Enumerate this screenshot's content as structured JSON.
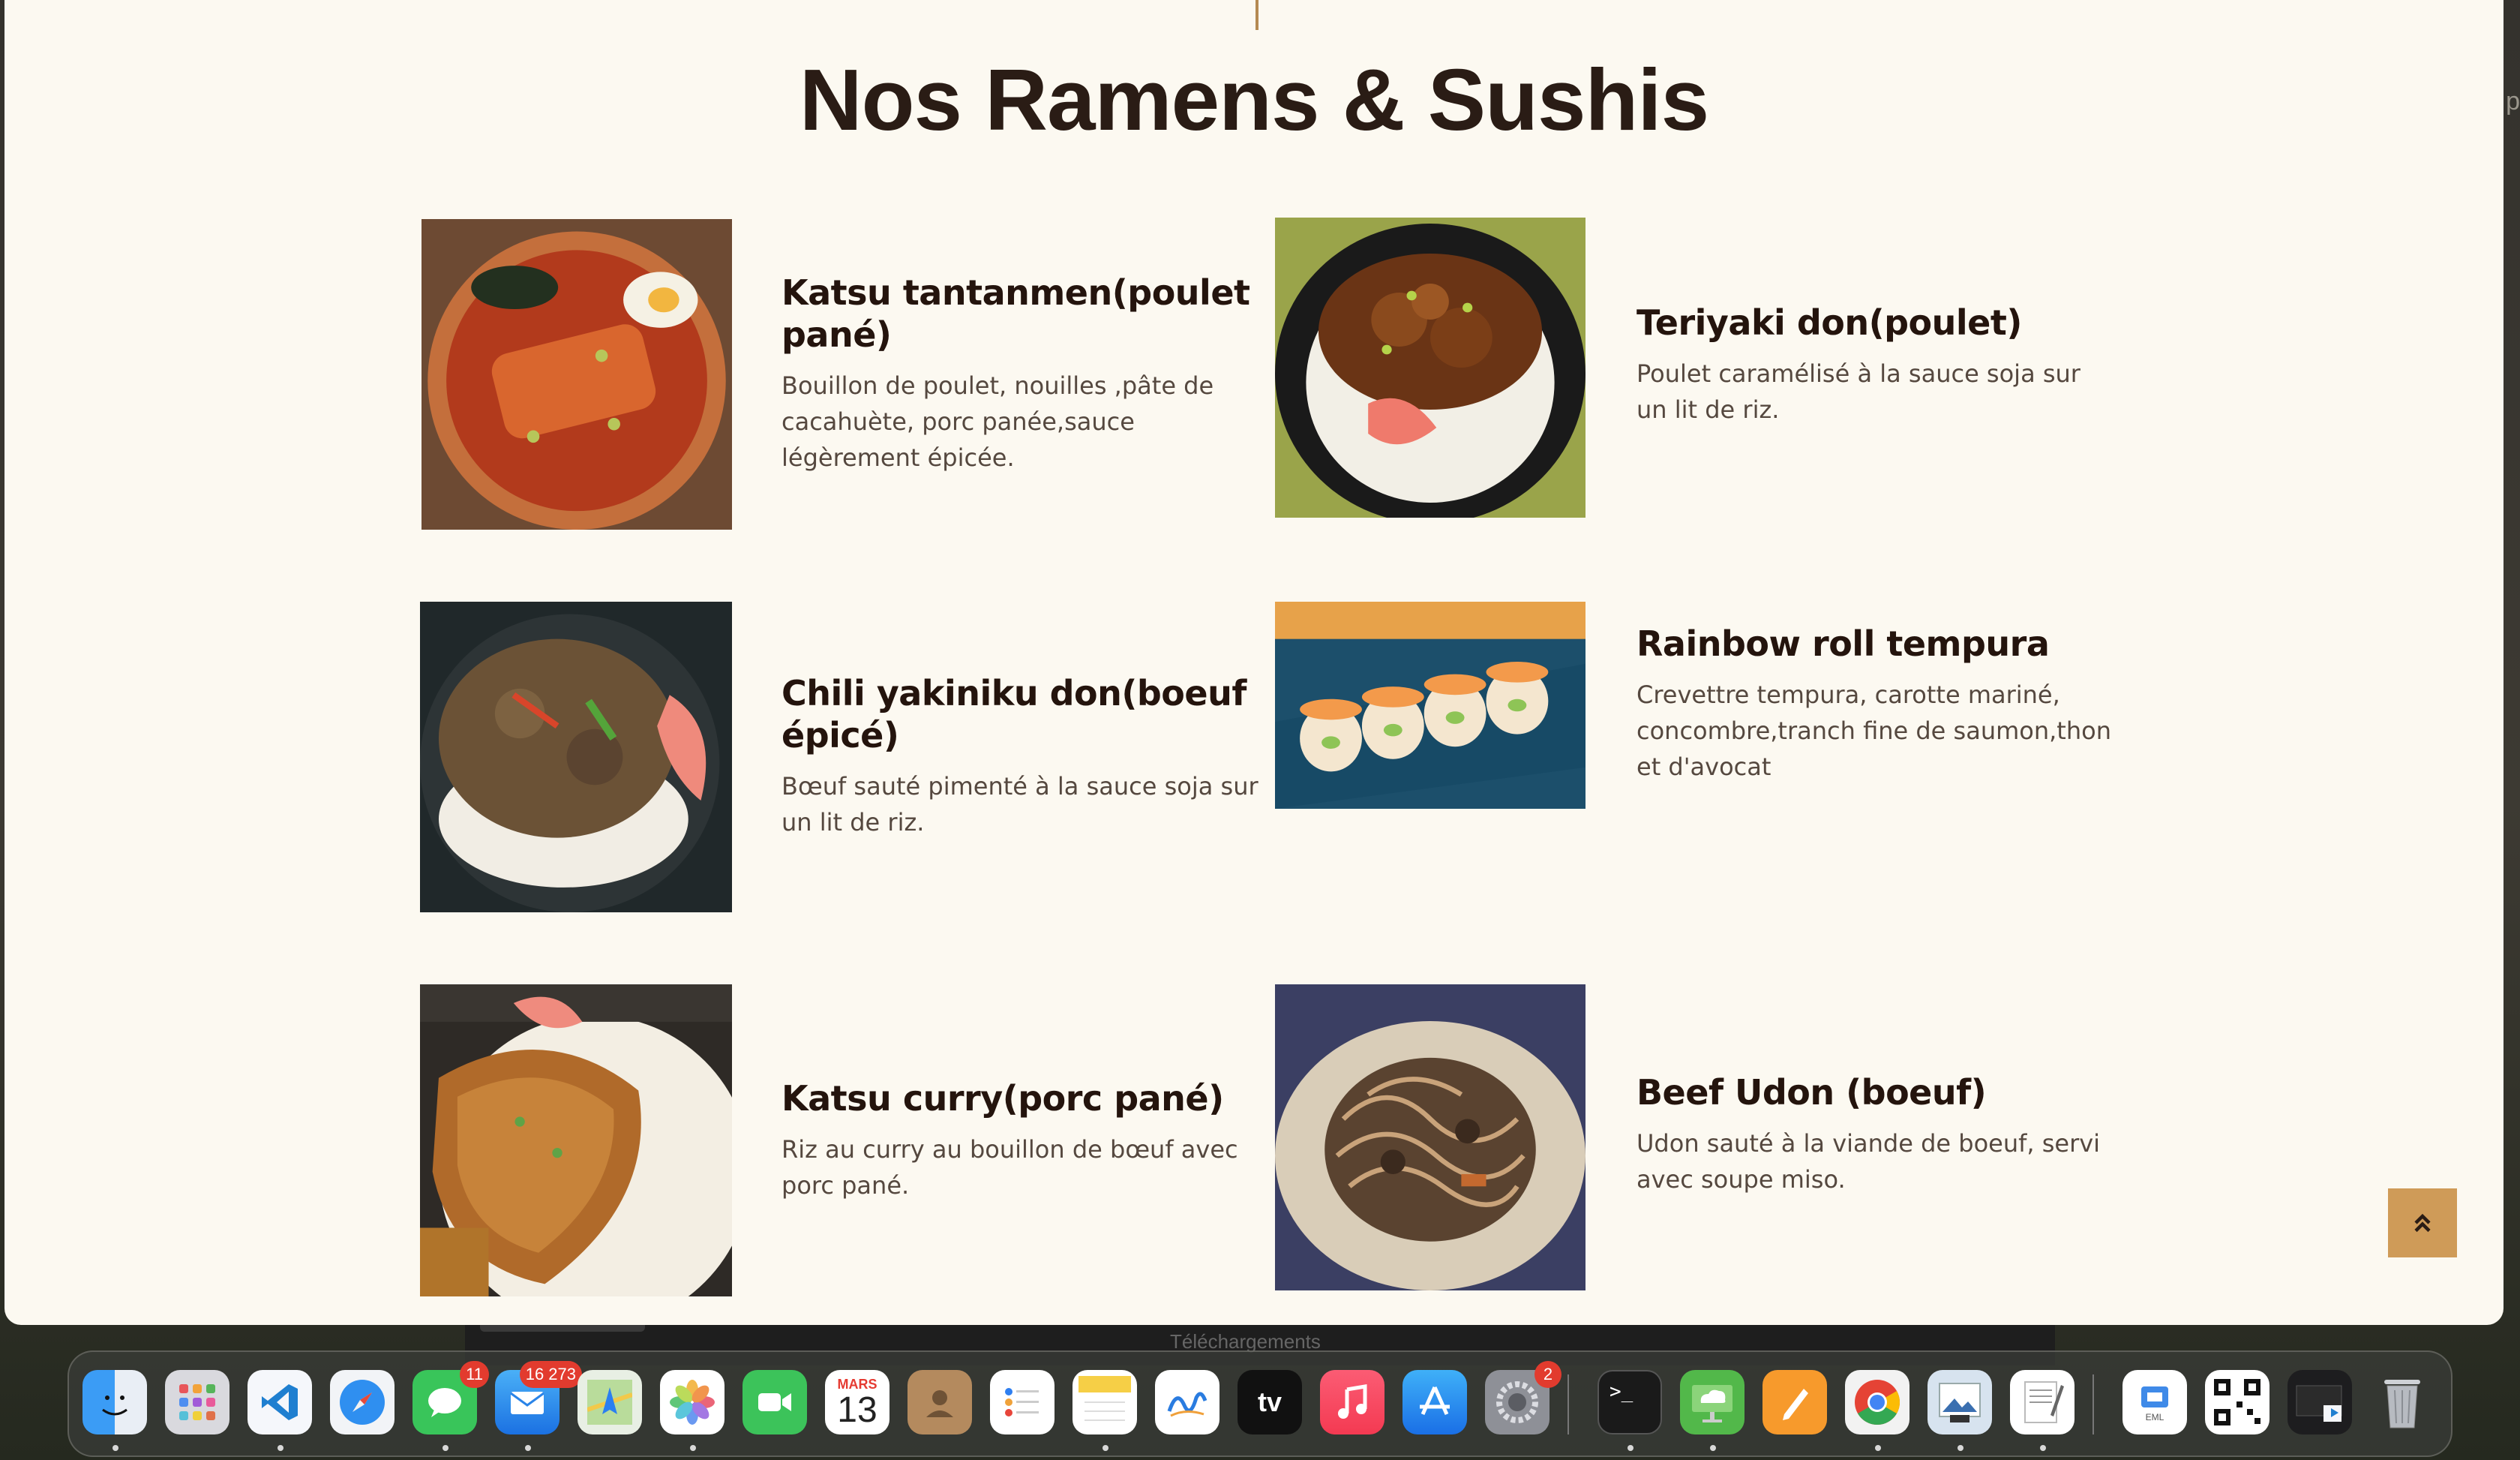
{
  "page": {
    "title": "Nos Ramens & Sushis",
    "edge_text": "p"
  },
  "dishes": [
    {
      "name": "Katsu tantanmen(poulet pané)",
      "desc": "Bouillon de poulet, nouilles ,pâte de cacahuète, porc panée,sauce légèrement épicée.",
      "photo": "katsu-tantanmen-photo"
    },
    {
      "name": "Teriyaki don(poulet)",
      "desc": "Poulet caramélisé à la sauce soja sur un lit de riz.",
      "photo": "teriyaki-don-photo"
    },
    {
      "name": "Chili yakiniku don(boeuf épicé)",
      "desc": "Bœuf sauté pimenté à la sauce soja sur un lit de riz.",
      "photo": "chili-yakiniku-don-photo"
    },
    {
      "name": "Rainbow roll tempura",
      "desc": "Crevettre tempura, carotte mariné, concombre,tranch fine de saumon,thon et d'avocat",
      "photo": "rainbow-roll-photo"
    },
    {
      "name": "Katsu curry(porc pané)",
      "desc": "Riz au curry au bouillon de bœuf avec porc pané.",
      "photo": "katsu-curry-photo"
    },
    {
      "name": "Beef Udon (boeuf)",
      "desc": "Udon sauté à la viande de boeuf, servi avec soupe miso.",
      "photo": "beef-udon-photo"
    }
  ],
  "back_to_top_icon": "double-chevron-up-icon",
  "background_window": {
    "label": "Téléchargements"
  },
  "dock": {
    "apps": [
      {
        "name": "finder-icon",
        "badge": ""
      },
      {
        "name": "launchpad-icon",
        "badge": ""
      },
      {
        "name": "vscode-icon",
        "badge": ""
      },
      {
        "name": "safari-icon",
        "badge": ""
      },
      {
        "name": "messages-icon",
        "badge": "11"
      },
      {
        "name": "mail-icon",
        "badge": "16 273"
      },
      {
        "name": "maps-icon",
        "badge": ""
      },
      {
        "name": "photos-icon",
        "badge": ""
      },
      {
        "name": "facetime-icon",
        "badge": ""
      },
      {
        "name": "calendar-icon",
        "badge": "",
        "month": "MARS",
        "day": "13"
      },
      {
        "name": "contacts-icon",
        "badge": ""
      },
      {
        "name": "reminders-icon",
        "badge": ""
      },
      {
        "name": "notes-icon",
        "badge": ""
      },
      {
        "name": "freeform-icon",
        "badge": ""
      },
      {
        "name": "apple-tv-icon",
        "badge": "",
        "label": "tv"
      },
      {
        "name": "music-icon",
        "badge": ""
      },
      {
        "name": "app-store-icon",
        "badge": ""
      },
      {
        "name": "system-settings-icon",
        "badge": "2"
      },
      {
        "name": "terminal-icon",
        "badge": ""
      },
      {
        "name": "remote-desktop-icon",
        "badge": ""
      },
      {
        "name": "pages-icon",
        "badge": ""
      },
      {
        "name": "chrome-icon",
        "badge": ""
      },
      {
        "name": "preview-icon",
        "badge": ""
      },
      {
        "name": "textedit-icon",
        "badge": ""
      },
      {
        "name": "eml-file-icon",
        "badge": "",
        "label": "EML"
      },
      {
        "name": "qr-code-icon",
        "badge": ""
      },
      {
        "name": "screenshot-stack-icon",
        "badge": ""
      },
      {
        "name": "trash-icon",
        "badge": ""
      }
    ]
  },
  "colors": {
    "page_bg": "#fcf9f1",
    "accent": "#cf9b58",
    "title": "#2a1c15",
    "text": "#55483f"
  }
}
